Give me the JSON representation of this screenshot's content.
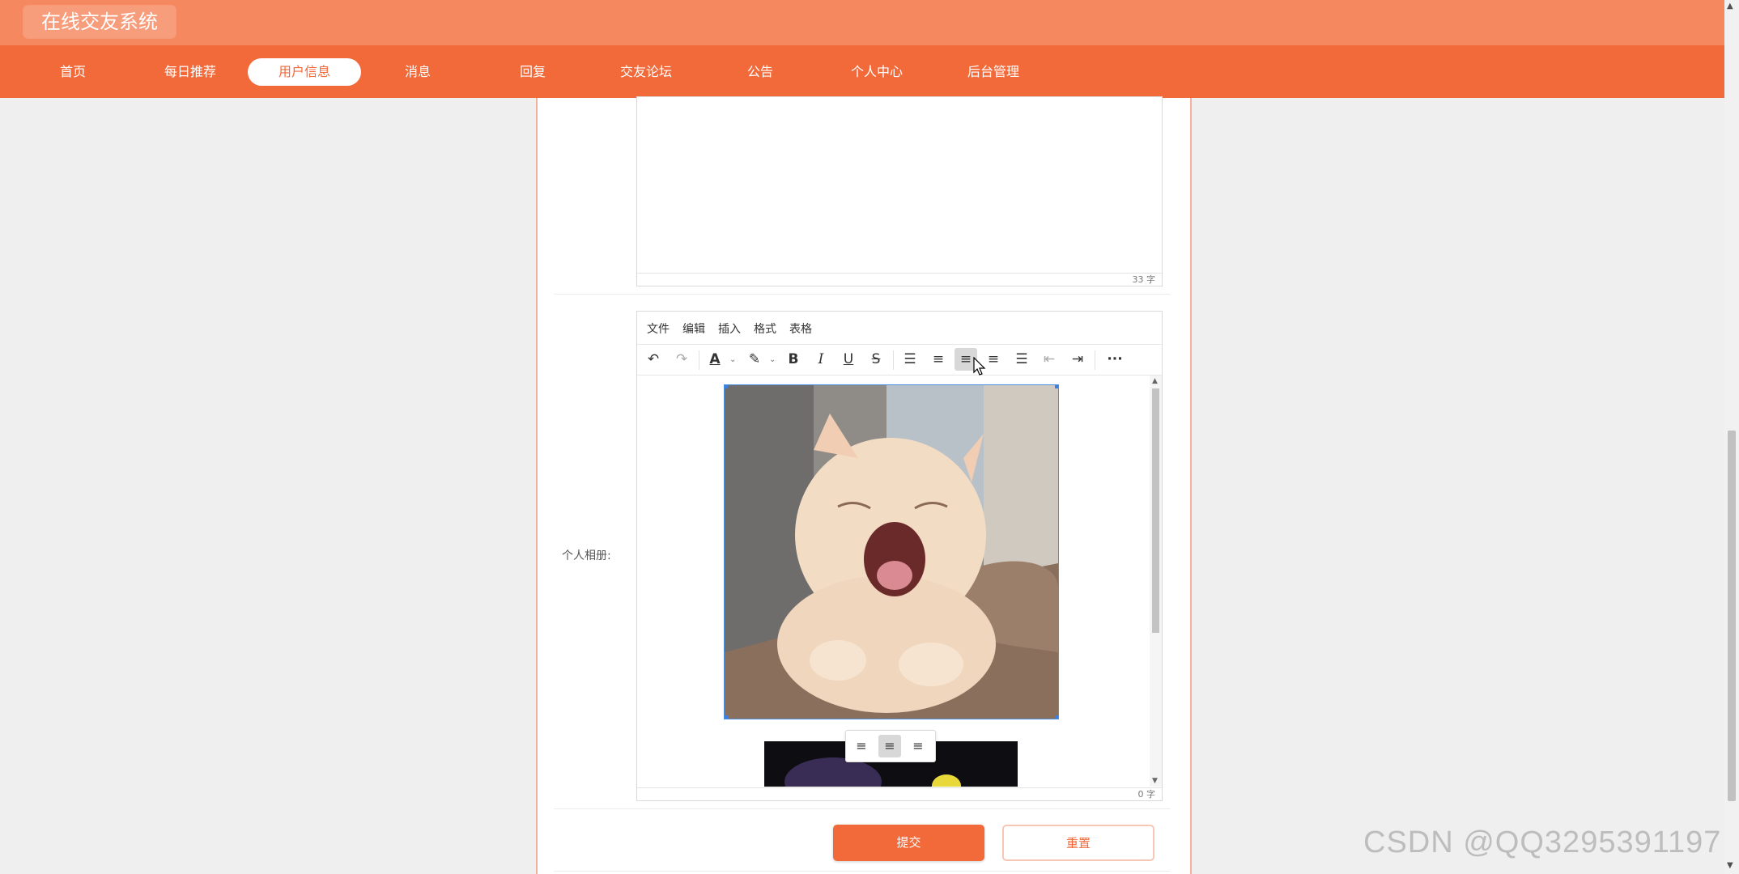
{
  "app": {
    "title": "在线交友系统"
  },
  "nav": {
    "items": [
      {
        "label": "首页"
      },
      {
        "label": "每日推荐"
      },
      {
        "label": "用户信息",
        "active": true
      },
      {
        "label": "消息"
      },
      {
        "label": "回复"
      },
      {
        "label": "交友论坛"
      },
      {
        "label": "公告"
      },
      {
        "label": "个人中心"
      },
      {
        "label": "后台管理"
      }
    ]
  },
  "editor1": {
    "word_count": "33 字"
  },
  "editor2": {
    "field_label": "个人相册:",
    "menu": [
      "文件",
      "编辑",
      "插入",
      "格式",
      "表格"
    ],
    "toolbar_icons": [
      "undo-icon",
      "redo-icon",
      "font-color-icon",
      "highlight-icon",
      "bold-icon",
      "italic-icon",
      "underline-icon",
      "strikethrough-icon",
      "list-icon",
      "align-left-icon",
      "align-center-icon",
      "align-right-icon",
      "justify-icon",
      "outdent-icon",
      "indent-icon",
      "more-icon"
    ],
    "word_count": "0 字"
  },
  "actions": {
    "submit_label": "提交",
    "reset_label": "重置"
  },
  "watermark": "CSDN @QQ3295391197",
  "colors": {
    "header": "#f6885f",
    "nav": "#f26a3a",
    "accent": "#f26a3a"
  }
}
